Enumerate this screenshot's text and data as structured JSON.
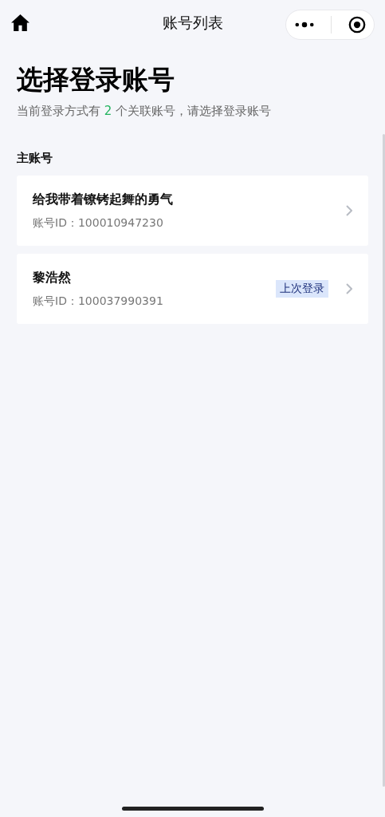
{
  "nav": {
    "title": "账号列表"
  },
  "heading": "选择登录账号",
  "subtitle": {
    "before": "当前登录方式有 ",
    "count": "2",
    "after": " 个关联账号，请选择登录账号"
  },
  "section_label": "主账号",
  "accounts": [
    {
      "name": "给我带着镣铐起舞的勇气",
      "id_label": "账号ID：",
      "id": "100010947230"
    },
    {
      "name": "黎浩然",
      "id_label": "账号ID：",
      "id": "100037990391",
      "badge": "上次登录"
    }
  ]
}
